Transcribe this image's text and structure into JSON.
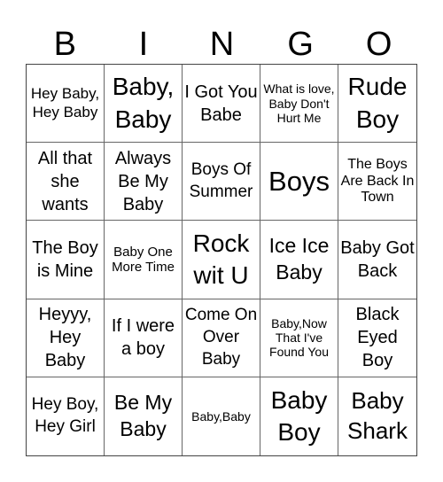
{
  "header": [
    "B",
    "I",
    "N",
    "G",
    "O"
  ],
  "cells": [
    {
      "text": "Hey Baby, Hey Baby",
      "size": "s17"
    },
    {
      "text": "Baby, Baby",
      "size": "s28"
    },
    {
      "text": "I Got You Babe",
      "size": "s20"
    },
    {
      "text": "What is love, Baby Don't Hurt Me",
      "size": "s14"
    },
    {
      "text": "Rude Boy",
      "size": "s28"
    },
    {
      "text": "All that she wants",
      "size": "s20"
    },
    {
      "text": "Always Be My Baby",
      "size": "s20"
    },
    {
      "text": "Boys Of Summer",
      "size": "s19"
    },
    {
      "text": "Boys",
      "size": "s31"
    },
    {
      "text": "The Boys Are Back In Town",
      "size": "s16"
    },
    {
      "text": "The Boy is Mine",
      "size": "s20"
    },
    {
      "text": "Baby One More Time",
      "size": "s15"
    },
    {
      "text": "Rock wit U",
      "size": "s28"
    },
    {
      "text": "Ice Ice Baby",
      "size": "s23"
    },
    {
      "text": "Baby Got Back",
      "size": "s20"
    },
    {
      "text": "Heyyy, Hey Baby",
      "size": "s20"
    },
    {
      "text": "If I were a boy",
      "size": "s20"
    },
    {
      "text": "Come On Over Baby",
      "size": "s19"
    },
    {
      "text": "Baby,Now That I've Found You",
      "size": "s14"
    },
    {
      "text": "Black Eyed Boy",
      "size": "s20"
    },
    {
      "text": "Hey Boy, Hey Girl",
      "size": "s19"
    },
    {
      "text": "Be My Baby",
      "size": "s23"
    },
    {
      "text": "Baby,Baby",
      "size": "s14"
    },
    {
      "text": "Baby Boy",
      "size": "s28"
    },
    {
      "text": "Baby Shark",
      "size": "s26"
    }
  ]
}
